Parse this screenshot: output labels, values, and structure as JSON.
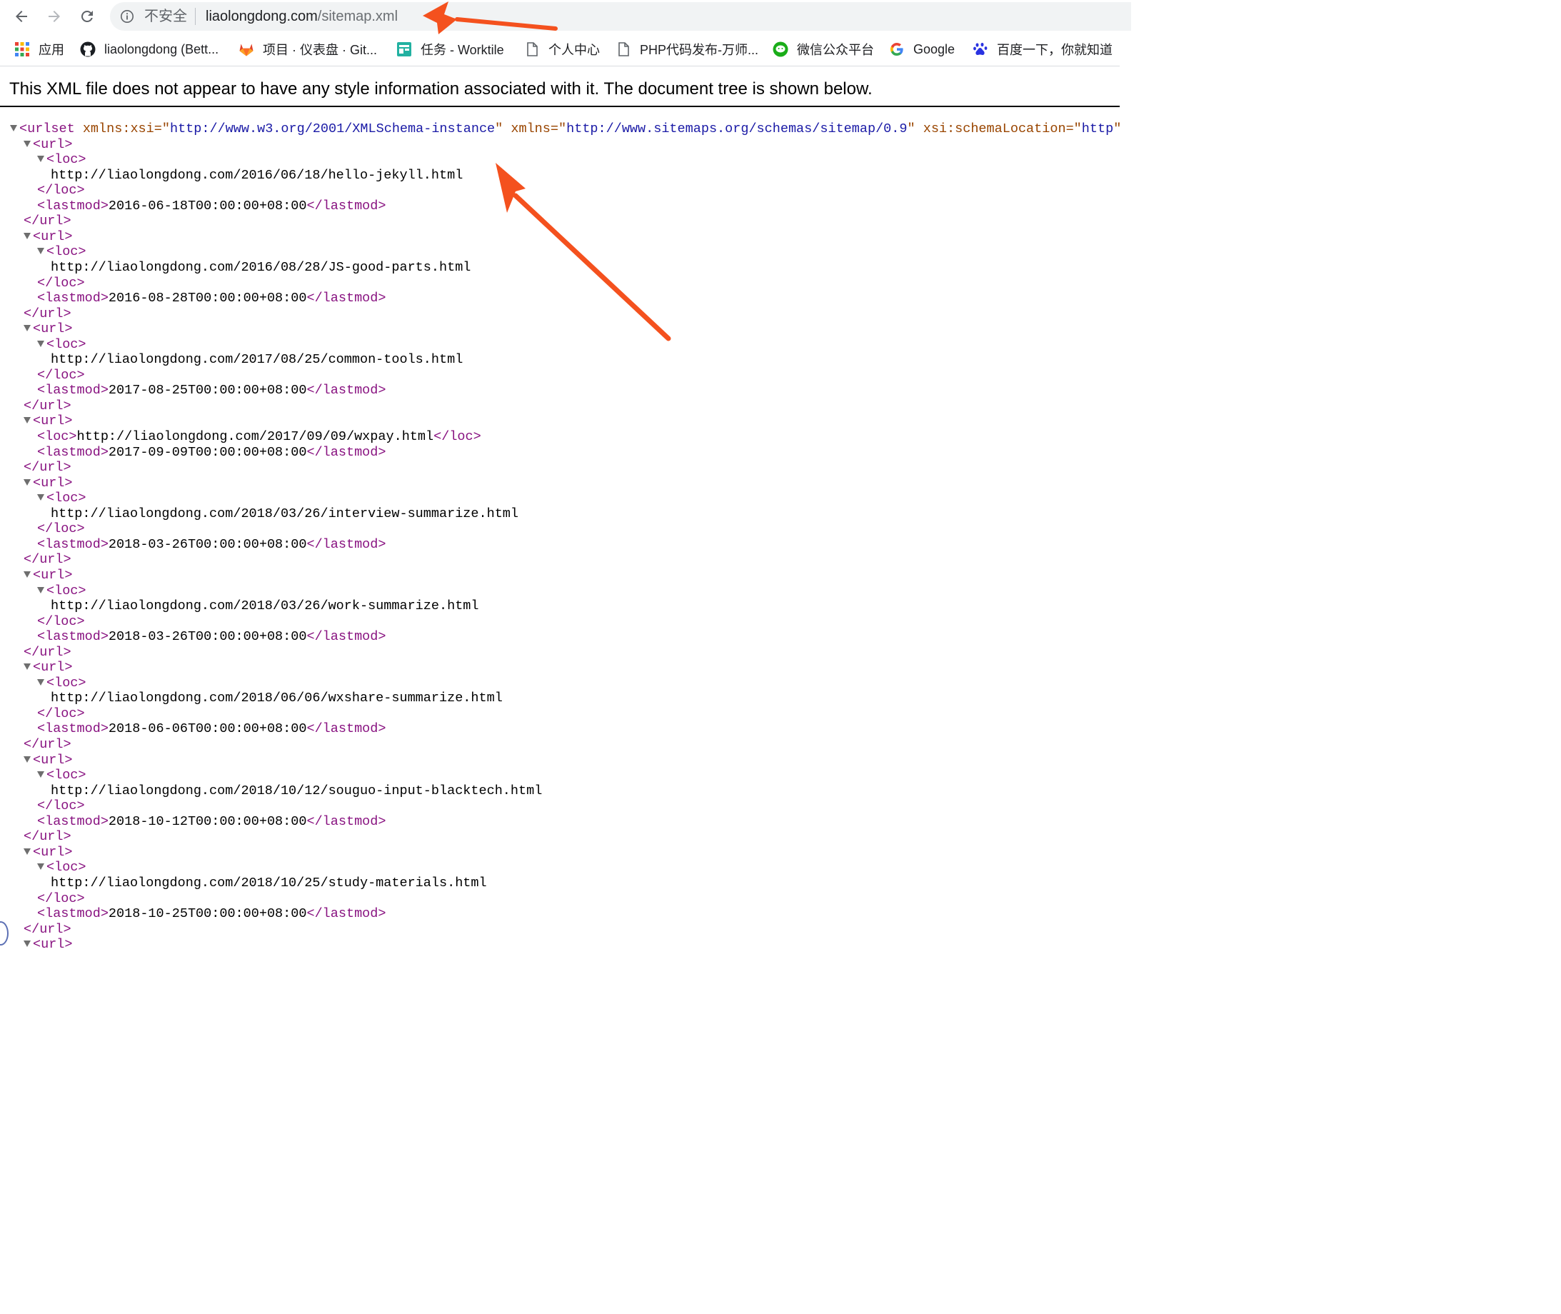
{
  "toolbar": {
    "omnibox": {
      "security_label": "不安全",
      "url_host": "liaolongdong.com",
      "url_path": "/sitemap.xml"
    }
  },
  "icons": {
    "back": "arrow-left-icon",
    "forward": "arrow-right-icon",
    "reload": "reload-icon",
    "info": "info-circle-icon"
  },
  "bookmarks": [
    {
      "label": "应用",
      "icon": "apps-grid-icon"
    },
    {
      "label": "liaolongdong (Bett...",
      "icon": "github-icon"
    },
    {
      "label": "项目 · 仪表盘 · Git...",
      "icon": "gitlab-icon"
    },
    {
      "label": "任务 - Worktile",
      "icon": "worktile-icon"
    },
    {
      "label": "个人中心",
      "icon": "page-icon"
    },
    {
      "label": "PHP代码发布-万师...",
      "icon": "page-icon"
    },
    {
      "label": "微信公众平台",
      "icon": "wechat-icon"
    },
    {
      "label": "Google",
      "icon": "google-icon"
    },
    {
      "label": "百度一下，你就知道",
      "icon": "baidu-icon"
    }
  ],
  "xml_notice": "This XML file does not appear to have any style information associated with it. The document tree is shown below.",
  "root": {
    "tag": "urlset",
    "attributes": [
      {
        "name": "xmlns:xsi",
        "value": "http://www.w3.org/2001/XMLSchema-instance"
      },
      {
        "name": "xmlns",
        "value": "http://www.sitemaps.org/schemas/sitemap/0.9"
      },
      {
        "name": "xsi:schemaLocation",
        "value": "http"
      }
    ]
  },
  "entries": [
    {
      "loc": "http://liaolongdong.com/2016/06/18/hello-jekyll.html",
      "lastmod": "2016-06-18T00:00:00+08:00",
      "inline": false
    },
    {
      "loc": "http://liaolongdong.com/2016/08/28/JS-good-parts.html",
      "lastmod": "2016-08-28T00:00:00+08:00",
      "inline": false
    },
    {
      "loc": "http://liaolongdong.com/2017/08/25/common-tools.html",
      "lastmod": "2017-08-25T00:00:00+08:00",
      "inline": false
    },
    {
      "loc": "http://liaolongdong.com/2017/09/09/wxpay.html",
      "lastmod": "2017-09-09T00:00:00+08:00",
      "inline": true
    },
    {
      "loc": "http://liaolongdong.com/2018/03/26/interview-summarize.html",
      "lastmod": "2018-03-26T00:00:00+08:00",
      "inline": false
    },
    {
      "loc": "http://liaolongdong.com/2018/03/26/work-summarize.html",
      "lastmod": "2018-03-26T00:00:00+08:00",
      "inline": false
    },
    {
      "loc": "http://liaolongdong.com/2018/06/06/wxshare-summarize.html",
      "lastmod": "2018-06-06T00:00:00+08:00",
      "inline": false
    },
    {
      "loc": "http://liaolongdong.com/2018/10/12/souguo-input-blacktech.html",
      "lastmod": "2018-10-12T00:00:00+08:00",
      "inline": false
    },
    {
      "loc": "http://liaolongdong.com/2018/10/25/study-materials.html",
      "lastmod": "2018-10-25T00:00:00+08:00",
      "inline": false
    }
  ],
  "annotation_color": "#f4511e"
}
